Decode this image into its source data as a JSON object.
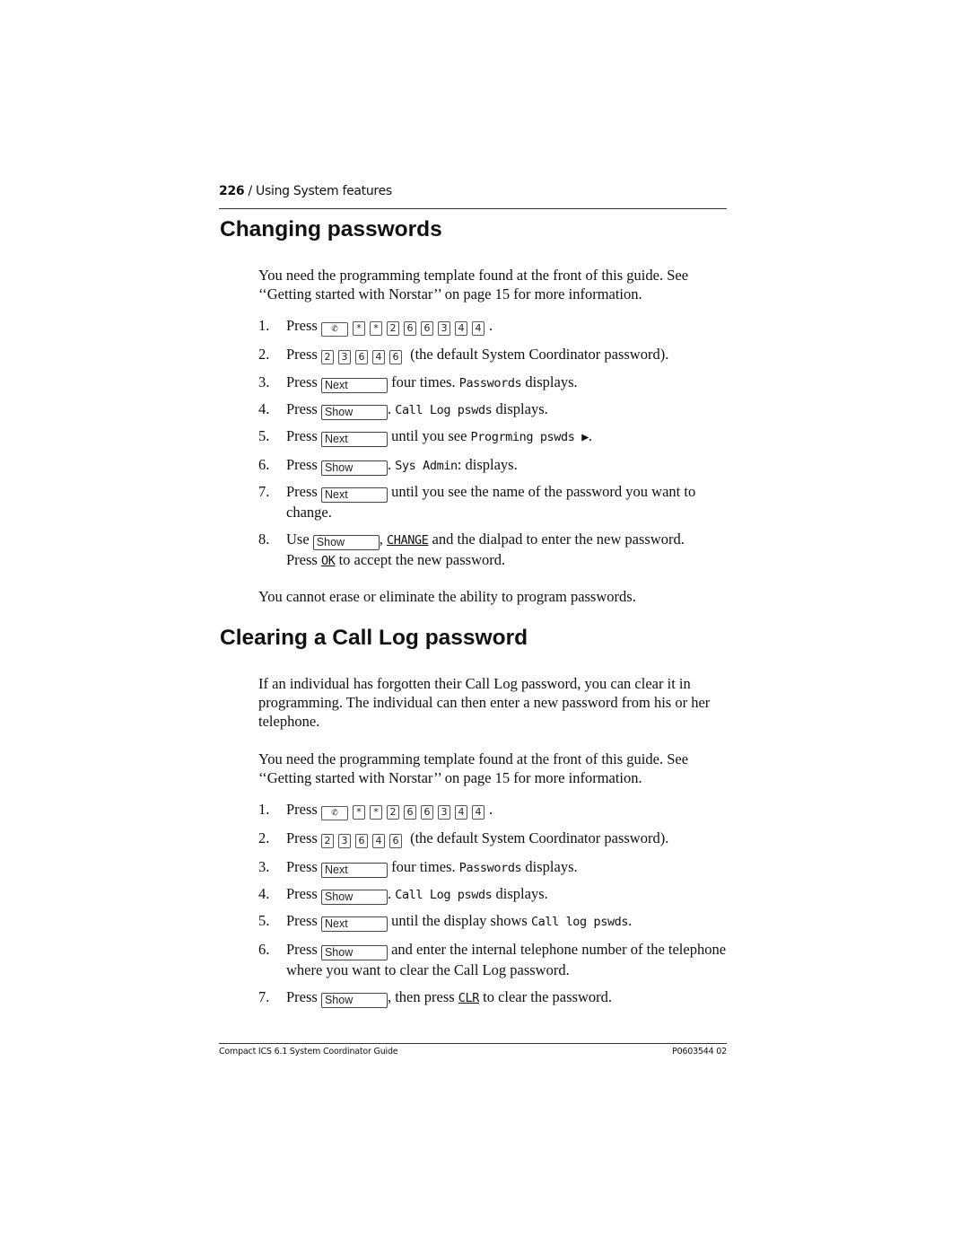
{
  "header": {
    "page_number": "226",
    "section": " / Using System features"
  },
  "section1": {
    "title": "Changing passwords",
    "intro": "You need the programming template found at the front of this guide. See ‘‘Getting started with Norstar’’ on page 15 for more information.",
    "steps": [
      {
        "n": "1.",
        "pre": "Press ",
        "keys": [
          "feature-icon",
          "*",
          "*",
          "2",
          "6",
          "6",
          "3",
          "4",
          "4"
        ],
        "post": "."
      },
      {
        "n": "2.",
        "pre": "Press ",
        "keys": [
          "2",
          "3",
          "6",
          "4",
          "6"
        ],
        "post": " (the default System Coordinator password)."
      },
      {
        "n": "3.",
        "pre": "Press ",
        "softkey": "Next",
        "mid": " four times. ",
        "lcd": "Passwords",
        "post": " displays."
      },
      {
        "n": "4.",
        "pre": "Press ",
        "softkey": "Show",
        "mid": ". ",
        "lcd": "Call Log pswds",
        "post": " displays."
      },
      {
        "n": "5.",
        "pre": "Press ",
        "softkey": "Next",
        "mid": " until you see ",
        "lcd": "Progrming pswds ▶",
        "post": "."
      },
      {
        "n": "6.",
        "pre": "Press ",
        "softkey": "Show",
        "mid": ". ",
        "lcd": "Sys Admin",
        "post": ": displays."
      },
      {
        "n": "7.",
        "pre": "Press ",
        "softkey": "Next",
        "mid": " until you see the name of the password you want to change.",
        "lcd": "",
        "post": ""
      },
      {
        "n": "8.",
        "pre": "Use ",
        "softkey": "Show",
        "mid": ", ",
        "lcd": "CHANGE",
        "post": " and the dialpad to enter the new password.",
        "line2_pre": "Press ",
        "line2_lcd": "OK",
        "line2_post": " to accept the new password."
      }
    ],
    "note": "You cannot erase or eliminate the ability to program passwords."
  },
  "section2": {
    "title": "Clearing a Call Log password",
    "intro": "If an individual has forgotten their Call Log password, you can clear it in programming. The individual can then enter a new password from his or her telephone.",
    "intro2": "You need the programming template found at the front of this guide. See ‘‘Getting started with Norstar’’ on page 15 for more information.",
    "steps": [
      {
        "n": "1.",
        "pre": "Press ",
        "keys": [
          "feature-icon",
          "*",
          "*",
          "2",
          "6",
          "6",
          "3",
          "4",
          "4"
        ],
        "post": "."
      },
      {
        "n": "2.",
        "pre": "Press ",
        "keys": [
          "2",
          "3",
          "6",
          "4",
          "6"
        ],
        "post": " (the default System Coordinator password)."
      },
      {
        "n": "3.",
        "pre": "Press ",
        "softkey": "Next",
        "mid": " four times. ",
        "lcd": "Passwords",
        "post": " displays."
      },
      {
        "n": "4.",
        "pre": "Press ",
        "softkey": "Show",
        "mid": ". ",
        "lcd": "Call Log pswds",
        "post": " displays."
      },
      {
        "n": "5.",
        "pre": "Press ",
        "softkey": "Next",
        "mid": " until the display shows ",
        "lcd": "Call log pswds",
        "post": "."
      },
      {
        "n": "6.",
        "pre": "Press ",
        "softkey": "Show",
        "mid": " and enter the internal telephone number of the telephone where you want to clear the Call Log password.",
        "lcd": "",
        "post": ""
      },
      {
        "n": "7.",
        "pre": "Press ",
        "softkey": "Show",
        "mid": ", then press ",
        "lcd": "CLR",
        "post": " to clear the password."
      }
    ]
  },
  "footer": {
    "left": "Compact ICS 6.1 System Coordinator Guide",
    "right": "P0603544  02"
  }
}
